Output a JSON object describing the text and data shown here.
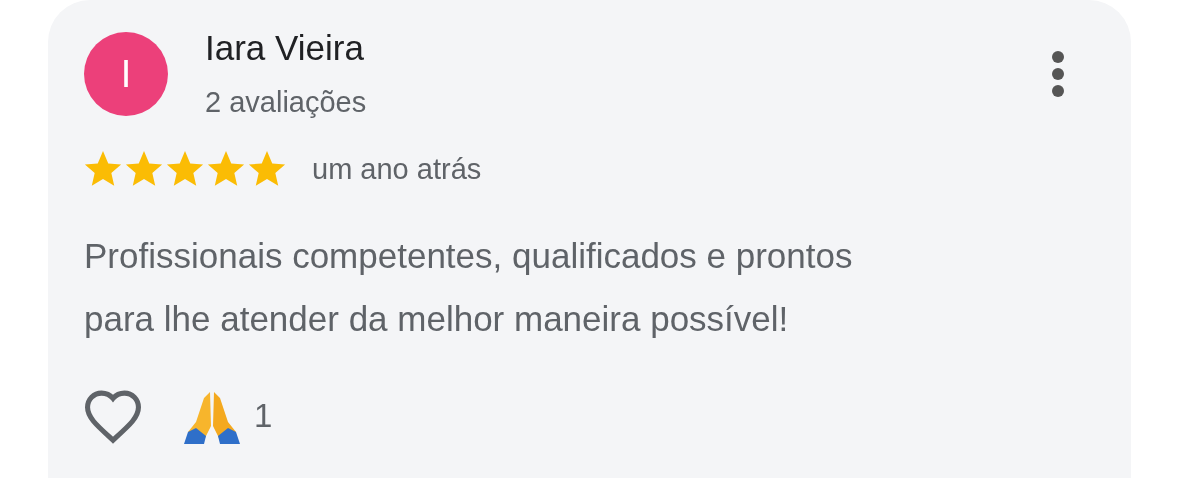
{
  "review": {
    "author": "Iara Vieira",
    "avatar": {
      "initial": "I",
      "color": "#ec407a"
    },
    "reviews_count": "2 avaliações",
    "stars": 5,
    "time": "um ano atrás",
    "text": "Profissionais competentes, qualificados e prontos para lhe atender da melhor maneira possível!",
    "liked": false,
    "reaction_count": "1"
  }
}
